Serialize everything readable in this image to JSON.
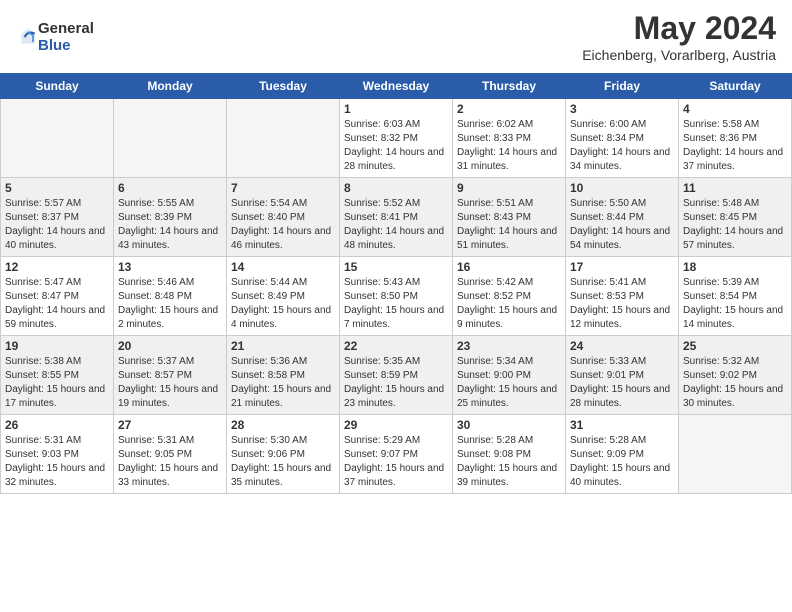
{
  "header": {
    "logo": {
      "general": "General",
      "blue": "Blue"
    },
    "title": "May 2024",
    "location": "Eichenberg, Vorarlberg, Austria"
  },
  "weekdays": [
    "Sunday",
    "Monday",
    "Tuesday",
    "Wednesday",
    "Thursday",
    "Friday",
    "Saturday"
  ],
  "weeks": [
    [
      {
        "day": "",
        "empty": true
      },
      {
        "day": "",
        "empty": true
      },
      {
        "day": "",
        "empty": true
      },
      {
        "day": "1",
        "sunrise": "6:03 AM",
        "sunset": "8:32 PM",
        "daylight": "14 hours and 28 minutes."
      },
      {
        "day": "2",
        "sunrise": "6:02 AM",
        "sunset": "8:33 PM",
        "daylight": "14 hours and 31 minutes."
      },
      {
        "day": "3",
        "sunrise": "6:00 AM",
        "sunset": "8:34 PM",
        "daylight": "14 hours and 34 minutes."
      },
      {
        "day": "4",
        "sunrise": "5:58 AM",
        "sunset": "8:36 PM",
        "daylight": "14 hours and 37 minutes."
      }
    ],
    [
      {
        "day": "5",
        "sunrise": "5:57 AM",
        "sunset": "8:37 PM",
        "daylight": "14 hours and 40 minutes."
      },
      {
        "day": "6",
        "sunrise": "5:55 AM",
        "sunset": "8:39 PM",
        "daylight": "14 hours and 43 minutes."
      },
      {
        "day": "7",
        "sunrise": "5:54 AM",
        "sunset": "8:40 PM",
        "daylight": "14 hours and 46 minutes."
      },
      {
        "day": "8",
        "sunrise": "5:52 AM",
        "sunset": "8:41 PM",
        "daylight": "14 hours and 48 minutes."
      },
      {
        "day": "9",
        "sunrise": "5:51 AM",
        "sunset": "8:43 PM",
        "daylight": "14 hours and 51 minutes."
      },
      {
        "day": "10",
        "sunrise": "5:50 AM",
        "sunset": "8:44 PM",
        "daylight": "14 hours and 54 minutes."
      },
      {
        "day": "11",
        "sunrise": "5:48 AM",
        "sunset": "8:45 PM",
        "daylight": "14 hours and 57 minutes."
      }
    ],
    [
      {
        "day": "12",
        "sunrise": "5:47 AM",
        "sunset": "8:47 PM",
        "daylight": "14 hours and 59 minutes."
      },
      {
        "day": "13",
        "sunrise": "5:46 AM",
        "sunset": "8:48 PM",
        "daylight": "15 hours and 2 minutes."
      },
      {
        "day": "14",
        "sunrise": "5:44 AM",
        "sunset": "8:49 PM",
        "daylight": "15 hours and 4 minutes."
      },
      {
        "day": "15",
        "sunrise": "5:43 AM",
        "sunset": "8:50 PM",
        "daylight": "15 hours and 7 minutes."
      },
      {
        "day": "16",
        "sunrise": "5:42 AM",
        "sunset": "8:52 PM",
        "daylight": "15 hours and 9 minutes."
      },
      {
        "day": "17",
        "sunrise": "5:41 AM",
        "sunset": "8:53 PM",
        "daylight": "15 hours and 12 minutes."
      },
      {
        "day": "18",
        "sunrise": "5:39 AM",
        "sunset": "8:54 PM",
        "daylight": "15 hours and 14 minutes."
      }
    ],
    [
      {
        "day": "19",
        "sunrise": "5:38 AM",
        "sunset": "8:55 PM",
        "daylight": "15 hours and 17 minutes."
      },
      {
        "day": "20",
        "sunrise": "5:37 AM",
        "sunset": "8:57 PM",
        "daylight": "15 hours and 19 minutes."
      },
      {
        "day": "21",
        "sunrise": "5:36 AM",
        "sunset": "8:58 PM",
        "daylight": "15 hours and 21 minutes."
      },
      {
        "day": "22",
        "sunrise": "5:35 AM",
        "sunset": "8:59 PM",
        "daylight": "15 hours and 23 minutes."
      },
      {
        "day": "23",
        "sunrise": "5:34 AM",
        "sunset": "9:00 PM",
        "daylight": "15 hours and 25 minutes."
      },
      {
        "day": "24",
        "sunrise": "5:33 AM",
        "sunset": "9:01 PM",
        "daylight": "15 hours and 28 minutes."
      },
      {
        "day": "25",
        "sunrise": "5:32 AM",
        "sunset": "9:02 PM",
        "daylight": "15 hours and 30 minutes."
      }
    ],
    [
      {
        "day": "26",
        "sunrise": "5:31 AM",
        "sunset": "9:03 PM",
        "daylight": "15 hours and 32 minutes."
      },
      {
        "day": "27",
        "sunrise": "5:31 AM",
        "sunset": "9:05 PM",
        "daylight": "15 hours and 33 minutes."
      },
      {
        "day": "28",
        "sunrise": "5:30 AM",
        "sunset": "9:06 PM",
        "daylight": "15 hours and 35 minutes."
      },
      {
        "day": "29",
        "sunrise": "5:29 AM",
        "sunset": "9:07 PM",
        "daylight": "15 hours and 37 minutes."
      },
      {
        "day": "30",
        "sunrise": "5:28 AM",
        "sunset": "9:08 PM",
        "daylight": "15 hours and 39 minutes."
      },
      {
        "day": "31",
        "sunrise": "5:28 AM",
        "sunset": "9:09 PM",
        "daylight": "15 hours and 40 minutes."
      },
      {
        "day": "",
        "empty": true
      }
    ]
  ]
}
